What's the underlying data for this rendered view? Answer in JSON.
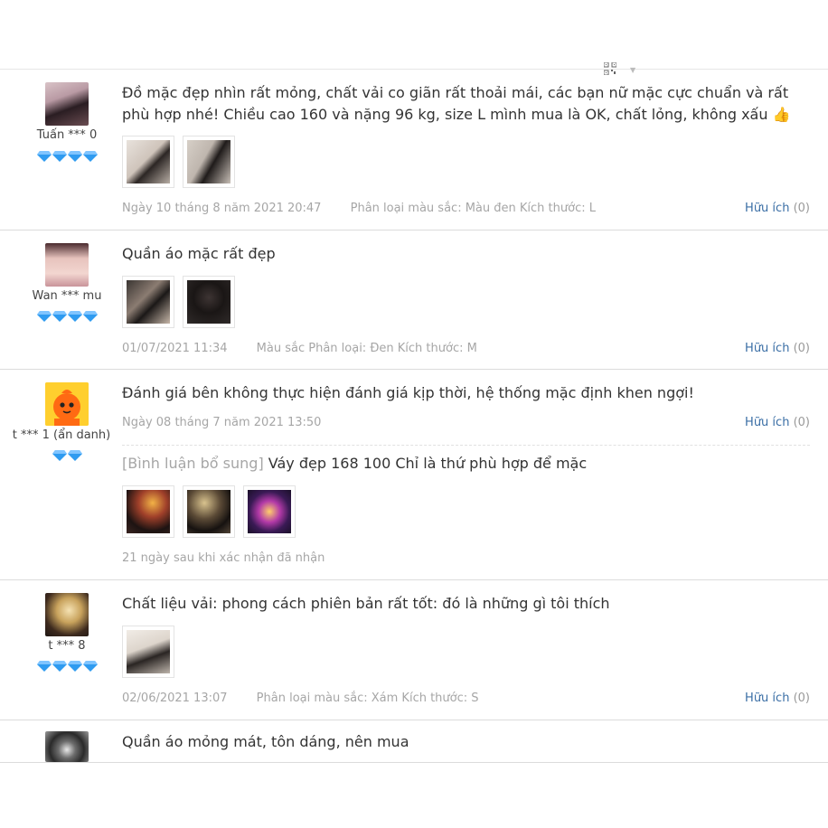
{
  "reviews": [
    {
      "username": "Tuấn *** 0",
      "gem_count": 4,
      "content": "Đồ mặc đẹp nhìn rất mỏng, chất vải co giãn rất thoải mái, các bạn nữ mặc cực chuẩn và rất phù hợp nhé! Chiều cao 160 và nặng 96 kg, size L mình mua là OK, chất lỏng, không xấu 👍",
      "date": "Ngày 10 tháng 8 năm 2021 20:47",
      "sku": "Phân loại màu sắc: Màu đen Kích thước: L",
      "useful_label": "Hữu ích",
      "useful_count": "(0)"
    },
    {
      "username": "Wan *** mu",
      "gem_count": 4,
      "content": "Quần áo mặc rất đẹp",
      "date": "01/07/2021 11:34",
      "sku": "Màu sắc Phân loại: Đen Kích thước: M",
      "useful_label": "Hữu ích",
      "useful_count": "(0)"
    },
    {
      "username": "t *** 1 (ẩn danh)",
      "gem_count": 2,
      "content": "Đánh giá bên không thực hiện đánh giá kịp thời, hệ thống mặc định khen ngợi!",
      "date": "Ngày 08 tháng 7 năm 2021 13:50",
      "useful_label": "Hữu ích",
      "useful_count": "(0)",
      "append_tag": "[Bình luận bổ sung]",
      "append_text": "Váy đẹp 168 100 Chỉ là thứ phù hợp để mặc",
      "append_time": "21 ngày sau khi xác nhận đã nhận"
    },
    {
      "username": "t *** 8",
      "gem_count": 4,
      "content": "Chất liệu vải: phong cách phiên bản rất tốt: đó là những gì tôi thích",
      "date": "02/06/2021 13:07",
      "sku": "Phân loại màu sắc: Xám Kích thước: S",
      "useful_label": "Hữu ích",
      "useful_count": "(0)"
    },
    {
      "content": "Quần áo mỏng mát, tôn dáng, nên mua"
    }
  ],
  "colors": {
    "link": "#3a6ea5",
    "meta": "#a6a6a6",
    "gem": "#2f9bf0",
    "divider": "#dcdcdc"
  }
}
